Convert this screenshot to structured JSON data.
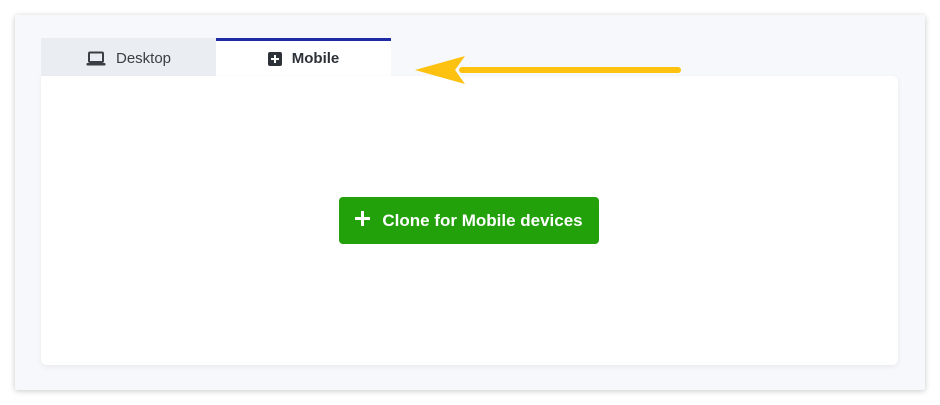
{
  "tabs": {
    "desktop": {
      "label": "Desktop",
      "icon": "laptop-icon",
      "active": false
    },
    "mobile": {
      "label": "Mobile",
      "icon": "plus-square-icon",
      "active": true
    }
  },
  "content": {
    "clone_button": {
      "label": "Clone for Mobile devices",
      "icon": "plus-icon"
    }
  },
  "annotation": {
    "type": "arrow",
    "color": "#fdc10f",
    "points_to": "tab-mobile"
  },
  "colors": {
    "active_tab_border": "#1f2aa5",
    "button_bg": "#22a10b",
    "inactive_tab_bg": "#eaedf1"
  }
}
